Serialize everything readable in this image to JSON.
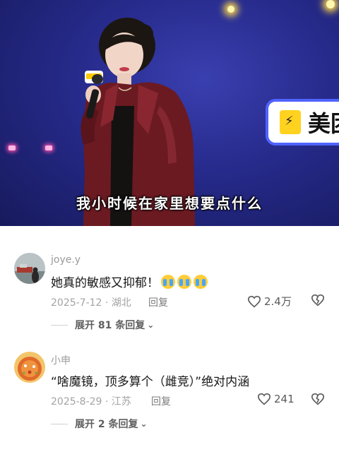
{
  "video": {
    "subtitle": "我小时候在家里想要点什么",
    "stage_sign_text": "美团"
  },
  "comments": [
    {
      "username": "joye.y",
      "text": "她真的敏感又抑郁！",
      "emoji": [
        "crying-face",
        "crying-face",
        "crying-face"
      ],
      "date": "2025-7-12",
      "location": "湖北",
      "meta": "2025-7-12 · 湖北",
      "reply_label": "回复",
      "likes": "2.4万",
      "expand_label": "展开 81 条回复"
    },
    {
      "username": "小申",
      "text": "“啥魔镜，顶多算个（雌竞）”绝对内涵",
      "date": "2025-8-29",
      "location": "江苏",
      "meta": "2025-8-29 · 江苏",
      "reply_label": "回复",
      "likes": "241",
      "expand_label": "展开 2 条回复"
    }
  ],
  "colors": {
    "stage_bg": "#262a8a",
    "jacket": "#6b1a22",
    "secondary_text": "#9a9a9a"
  }
}
